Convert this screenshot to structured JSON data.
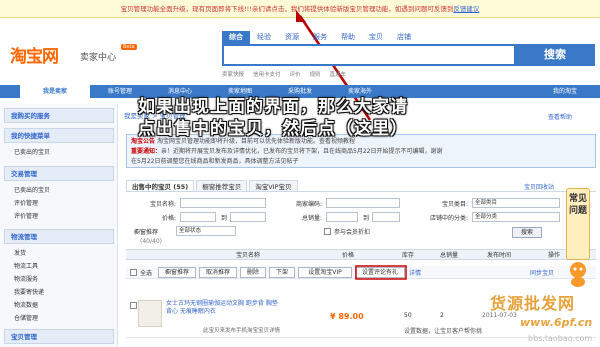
{
  "notice": {
    "text": "宝贝管理功能全面升级，现有页面即将下线!!!亲们请点击",
    "text2": "，我们将提供体验新版宝贝管理功能，如遇到问题可反馈到",
    "link": "反馈建议"
  },
  "header": {
    "logo": "淘宝网",
    "subtitle": "卖家中心",
    "beta": "Beta",
    "search_tabs": [
      "综合",
      "经验",
      "资源",
      "服务",
      "帮助",
      "宝贝",
      "店铺"
    ],
    "search_button": "搜索",
    "sublinks": [
      "卖家快报",
      "信用卡支付",
      "评价",
      "规则",
      "直通车"
    ]
  },
  "nav": {
    "items": [
      "我是卖家",
      "账号管理",
      "消息中心",
      "卖家地图",
      "采购批发",
      "卖家海外"
    ],
    "right": "我的淘宝"
  },
  "sidebar": {
    "sections": [
      {
        "title": "我购买的服务",
        "items": []
      },
      {
        "title": "我的快捷菜单",
        "items": [
          "已卖出的宝贝"
        ]
      },
      {
        "title": "交易管理",
        "items": [
          "已卖出的宝贝",
          "评价管理",
          "评价管理"
        ]
      },
      {
        "title": "物流管理",
        "items": [
          "发货",
          "物流工具",
          "物流服务",
          "我要寄快递",
          "物流数据",
          "仓储管理"
        ]
      },
      {
        "title": "宝贝管理",
        "items": []
      }
    ]
  },
  "main": {
    "breadcrumb": "我是卖家 > 宝贝管理",
    "help": "查看帮助",
    "announce_title": "淘宝公告",
    "announce_line1": "淘宝网宝贝管理功能即将升级，目前可以优先体验新版功能。查看视频教程",
    "announce_label": "重要通知：",
    "announce_line2": "亲！近期将开展宝贝发布及详情优化，已发布的宝贝将下架，且在线商品5月22日开始提示不可编辑，谢谢",
    "announce_line3": "在5月22日前调整您在线商品和新发商品，具体调整方法见帖子"
  },
  "tabs": [
    "出售中的宝贝 (55)",
    "橱窗推荐宝贝",
    "淘宝VIP宝贝"
  ],
  "goods_link": "宝贝回收站",
  "filters": {
    "name_label": "宝贝名称:",
    "code_label": "商家编码:",
    "category_label": "宝贝类目:",
    "category_value": "全部类目",
    "price_label": "价格:",
    "sales_label": "总销量:",
    "store_cat_label": "店铺中的分类:",
    "store_cat_value": "全部分类",
    "to": "到",
    "showcase_label": "橱窗推荐",
    "showcase_value": "全部状态",
    "showcase_count": "(40/40)",
    "vip_label": "参与会员折扣",
    "search_button": "搜索"
  },
  "columns": [
    "宝贝名称",
    "价格",
    "库存",
    "总销量",
    "发布时间",
    "操作"
  ],
  "actions": [
    "全选",
    "橱窗推荐",
    "取消推荐",
    "删除",
    "下架",
    "设置淘宝VIP",
    "设置评论有礼",
    "详情"
  ],
  "actions_right": "同步宝贝",
  "item": {
    "title": "女士古玛无钢圈瑜伽运动文胸 跑步背 胸垫背心 无痕睡眠内衣",
    "price": "¥ 89.00",
    "stock": "50",
    "sold": "2",
    "date": "2011-07-03",
    "note": "此宝贝来发布手机淘宝宝贝详情",
    "warn": "设置数据，让宝贝客户帮你挑"
  },
  "overlay": {
    "line1": "如果出现上面的界面，那么大家请",
    "line2": "点出售中的宝贝，然后点（这里）"
  },
  "faq": "常见问题",
  "watermark": {
    "line1": "货源批发网",
    "line2": "www.6pf.cn",
    "line3": "bbs.taobao.com"
  }
}
